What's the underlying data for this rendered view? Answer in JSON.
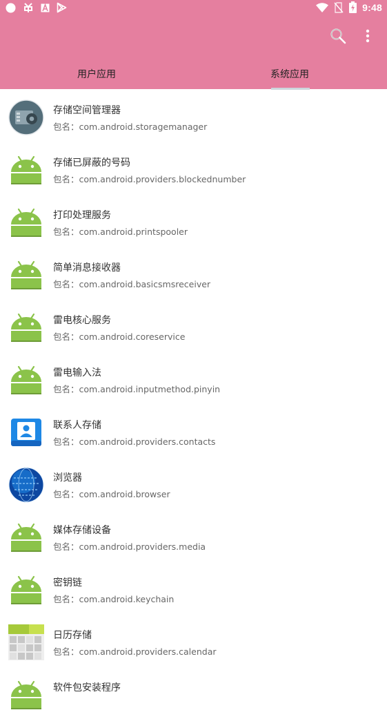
{
  "status_bar": {
    "time": "9:48",
    "left_icons": [
      "circle-icon",
      "bug-icon",
      "font-a-icon",
      "play-store-icon"
    ],
    "right_icons": [
      "wifi-icon",
      "no-sim-icon",
      "battery-charging-icon"
    ]
  },
  "toolbar": {
    "search_icon": "search-icon",
    "more_icon": "more-vert-icon",
    "background": "#e57f9f"
  },
  "tabs": [
    {
      "label": "用户应用",
      "selected": false
    },
    {
      "label": "系统应用",
      "selected": true
    }
  ],
  "apps": [
    {
      "name": "存储空间管理器",
      "package": "包名：com.android.storagemanager",
      "icon": "storage-manager-icon"
    },
    {
      "name": "存储已屏蔽的号码",
      "package": "包名：com.android.providers.blockednumber",
      "icon": "android-icon"
    },
    {
      "name": "打印处理服务",
      "package": "包名：com.android.printspooler",
      "icon": "android-icon"
    },
    {
      "name": "简单消息接收器",
      "package": "包名：com.android.basicsmsreceiver",
      "icon": "android-icon"
    },
    {
      "name": "雷电核心服务",
      "package": "包名：com.android.coreservice",
      "icon": "android-icon"
    },
    {
      "name": "雷电输入法",
      "package": "包名：com.android.inputmethod.pinyin",
      "icon": "android-icon"
    },
    {
      "name": "联系人存储",
      "package": "包名：com.android.providers.contacts",
      "icon": "contacts-icon"
    },
    {
      "name": "浏览器",
      "package": "包名：com.android.browser",
      "icon": "browser-globe-icon"
    },
    {
      "name": "媒体存储设备",
      "package": "包名：com.android.providers.media",
      "icon": "android-icon"
    },
    {
      "name": "密钥链",
      "package": "包名：com.android.keychain",
      "icon": "android-icon"
    },
    {
      "name": "日历存储",
      "package": "包名：com.android.providers.calendar",
      "icon": "calendar-icon"
    },
    {
      "name": "软件包安装程序",
      "package": "",
      "icon": "android-icon"
    }
  ]
}
